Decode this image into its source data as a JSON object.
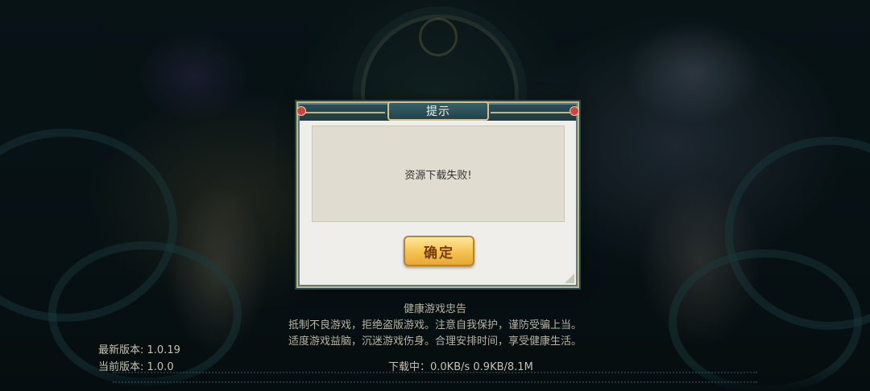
{
  "dialog": {
    "title": "提示",
    "message": "资源下载失败!",
    "confirm_label": "确定"
  },
  "health_notice": {
    "title": "健康游戏忠告",
    "line1": "抵制不良游戏，拒绝盗版游戏。注意自我保护，谨防受骗上当。",
    "line2": "适度游戏益脑，沉迷游戏伤身。合理安排时间，享受健康生活。"
  },
  "version": {
    "latest": "最新版本: 1.0.19",
    "current": "当前版本: 1.0.0"
  },
  "download_status": "下载中：0.0KB/s  0.9KB/8.1M",
  "colors": {
    "button": "#f6c24f",
    "dialog_border": "#5a7f86",
    "accent_gold": "#c8b47a"
  }
}
